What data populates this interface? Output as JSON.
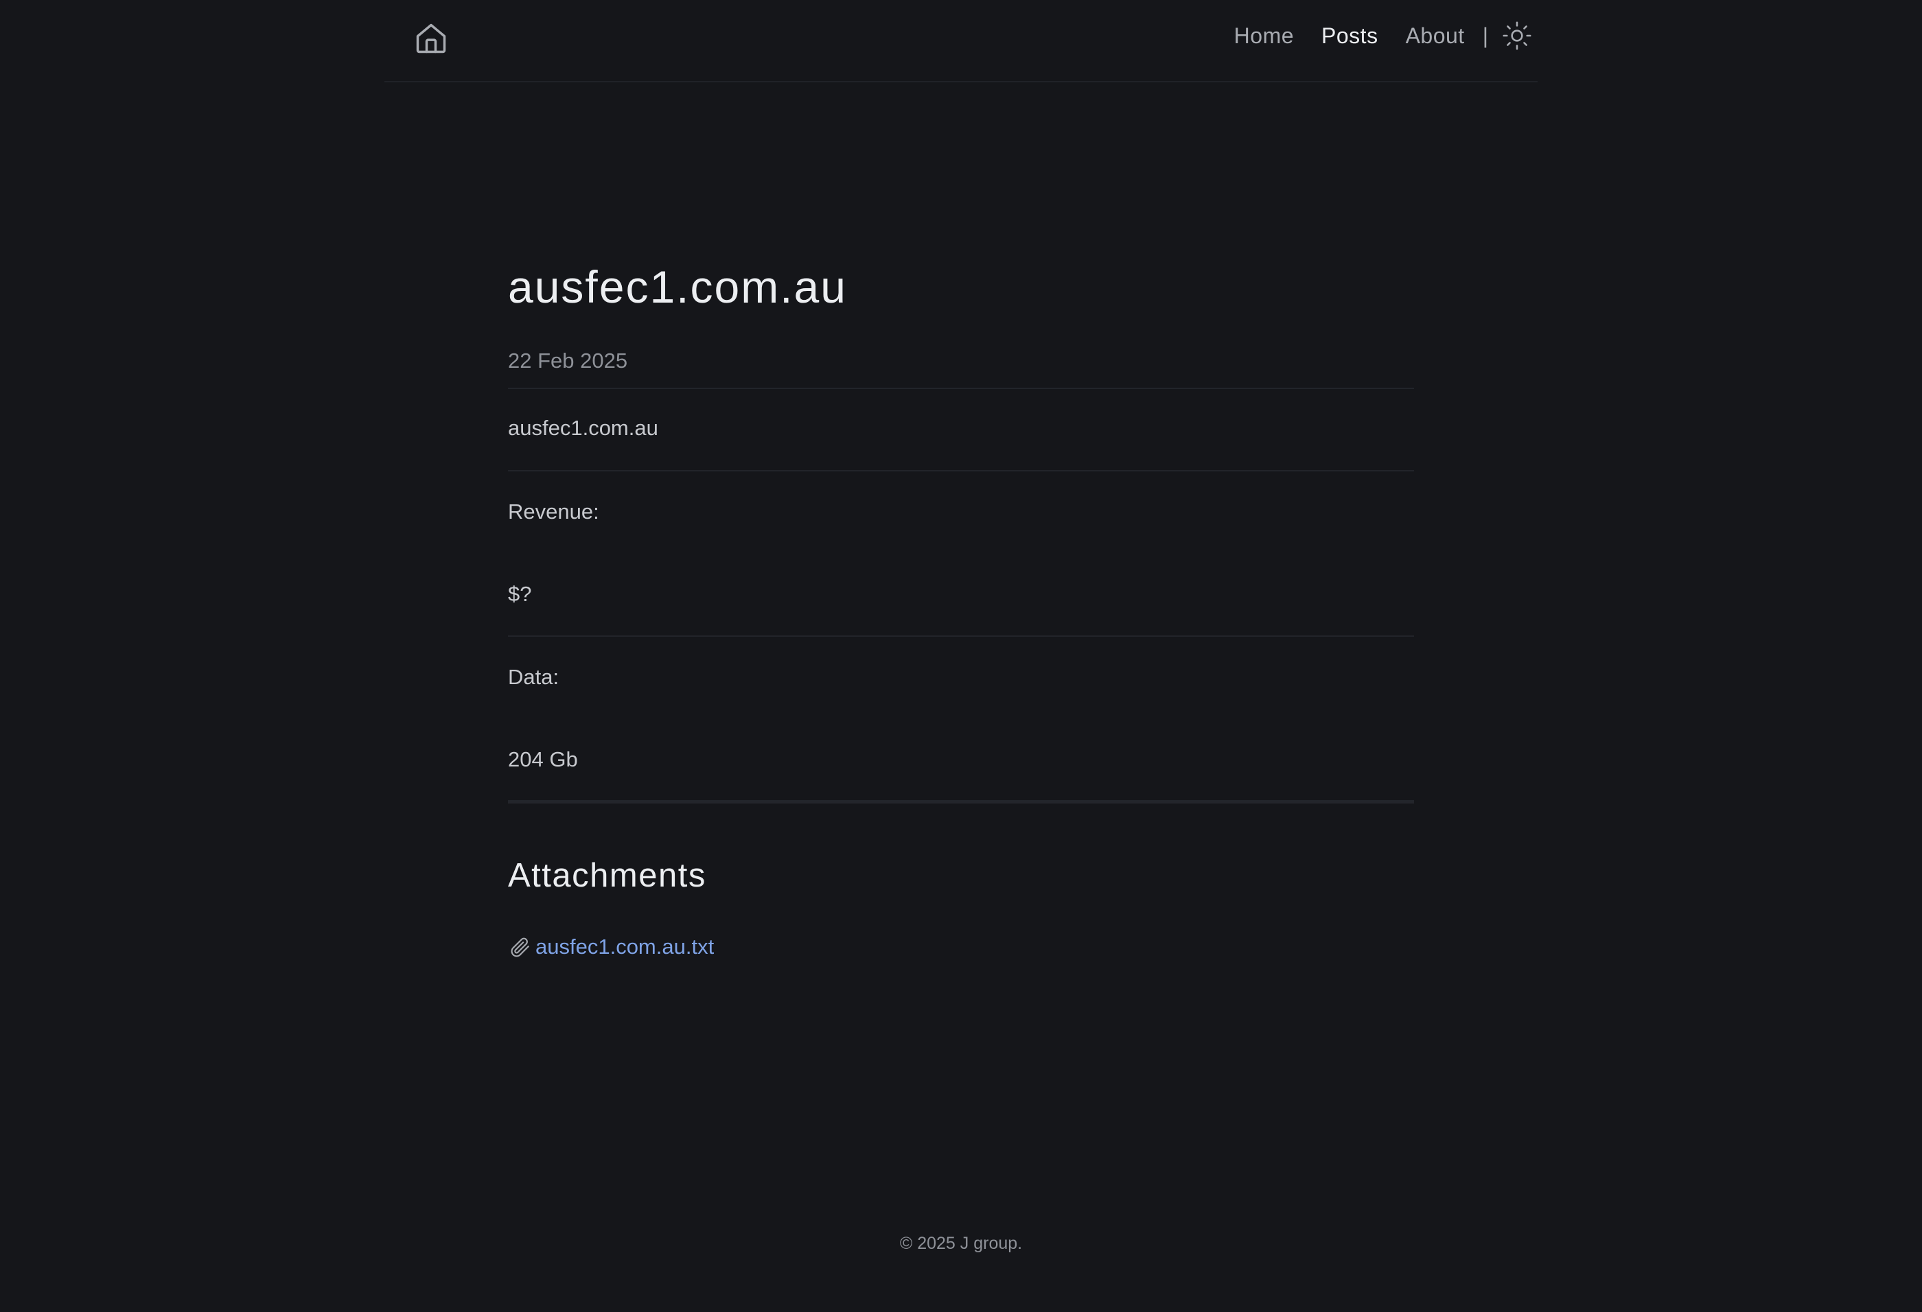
{
  "header": {
    "logo_icon": "home-icon",
    "nav": {
      "home": "Home",
      "posts": "Posts",
      "about": "About",
      "separator": "|"
    },
    "theme_toggle_icon": "sun-icon"
  },
  "post": {
    "title": "ausfec1.com.au",
    "date": "22 Feb 2025",
    "body_domain": "ausfec1.com.au",
    "revenue_label": "Revenue:",
    "revenue_value": "$?",
    "data_label": "Data:",
    "data_value": "204 Gb"
  },
  "attachments": {
    "heading": "Attachments",
    "icon": "paperclip-icon",
    "file_name": "ausfec1.com.au.txt"
  },
  "footer": {
    "copyright": "© 2025 J group."
  },
  "colors": {
    "background": "#15161a",
    "text_primary": "#eceef1",
    "text_muted": "#8e9198",
    "link": "#7fa3e6"
  }
}
